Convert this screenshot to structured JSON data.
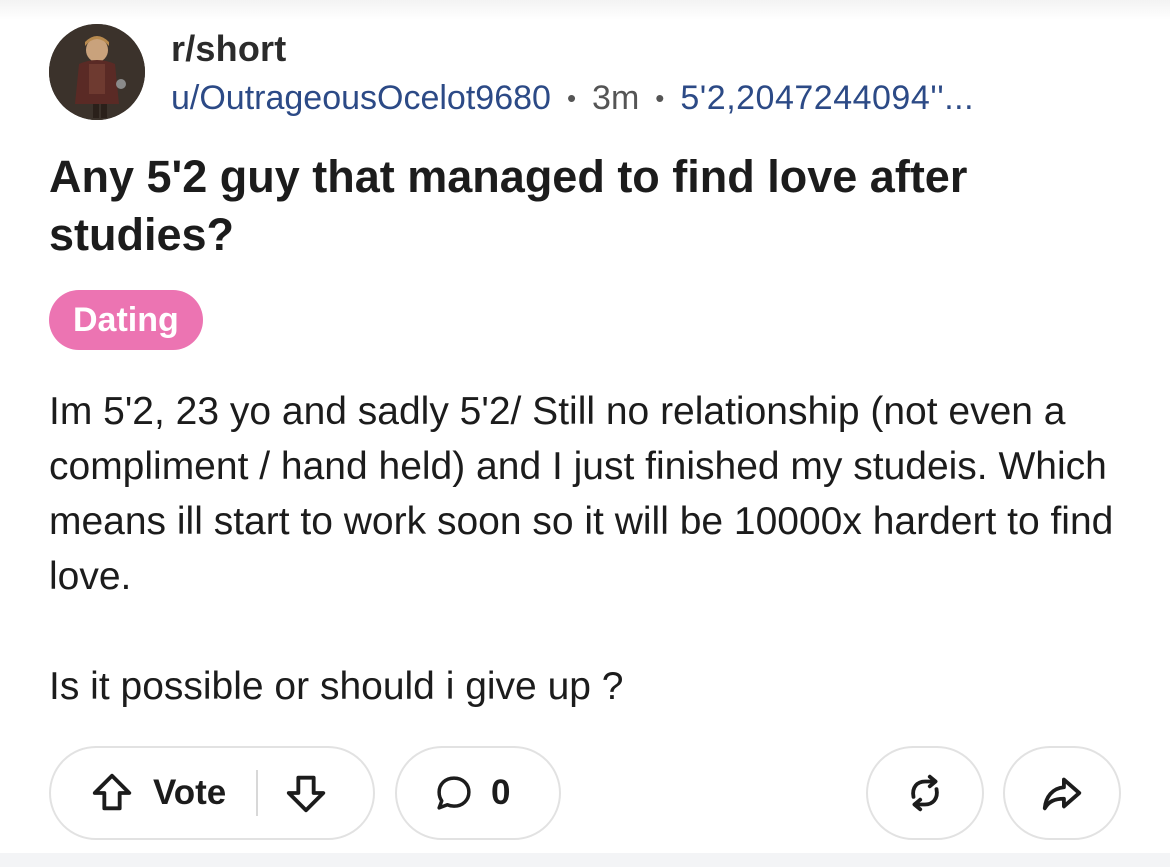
{
  "post": {
    "subreddit": "r/short",
    "username": "u/OutrageousOcelot9680",
    "age": "3m",
    "user_flair": "5'2,2047244094''...",
    "title": "Any 5'2 guy that managed to find love after studies?",
    "flair": "Dating",
    "flair_color": "#ec74b2",
    "body_paragraphs": [
      "Im 5'2, 23 yo and sadly 5'2/ Still no relationship (not even a compliment / hand held) and I just finished my studeis. Which means ill start to work soon so it will be 10000x hardert to find love.",
      "Is it possible or should i give up ?"
    ]
  },
  "actions": {
    "vote_label": "Vote",
    "comments_count": "0",
    "icons": {
      "upvote": "upvote-arrow-icon",
      "downvote": "downvote-arrow-icon",
      "comment": "comment-bubble-icon",
      "crosspost": "crosspost-icon",
      "share": "share-arrow-icon"
    }
  }
}
